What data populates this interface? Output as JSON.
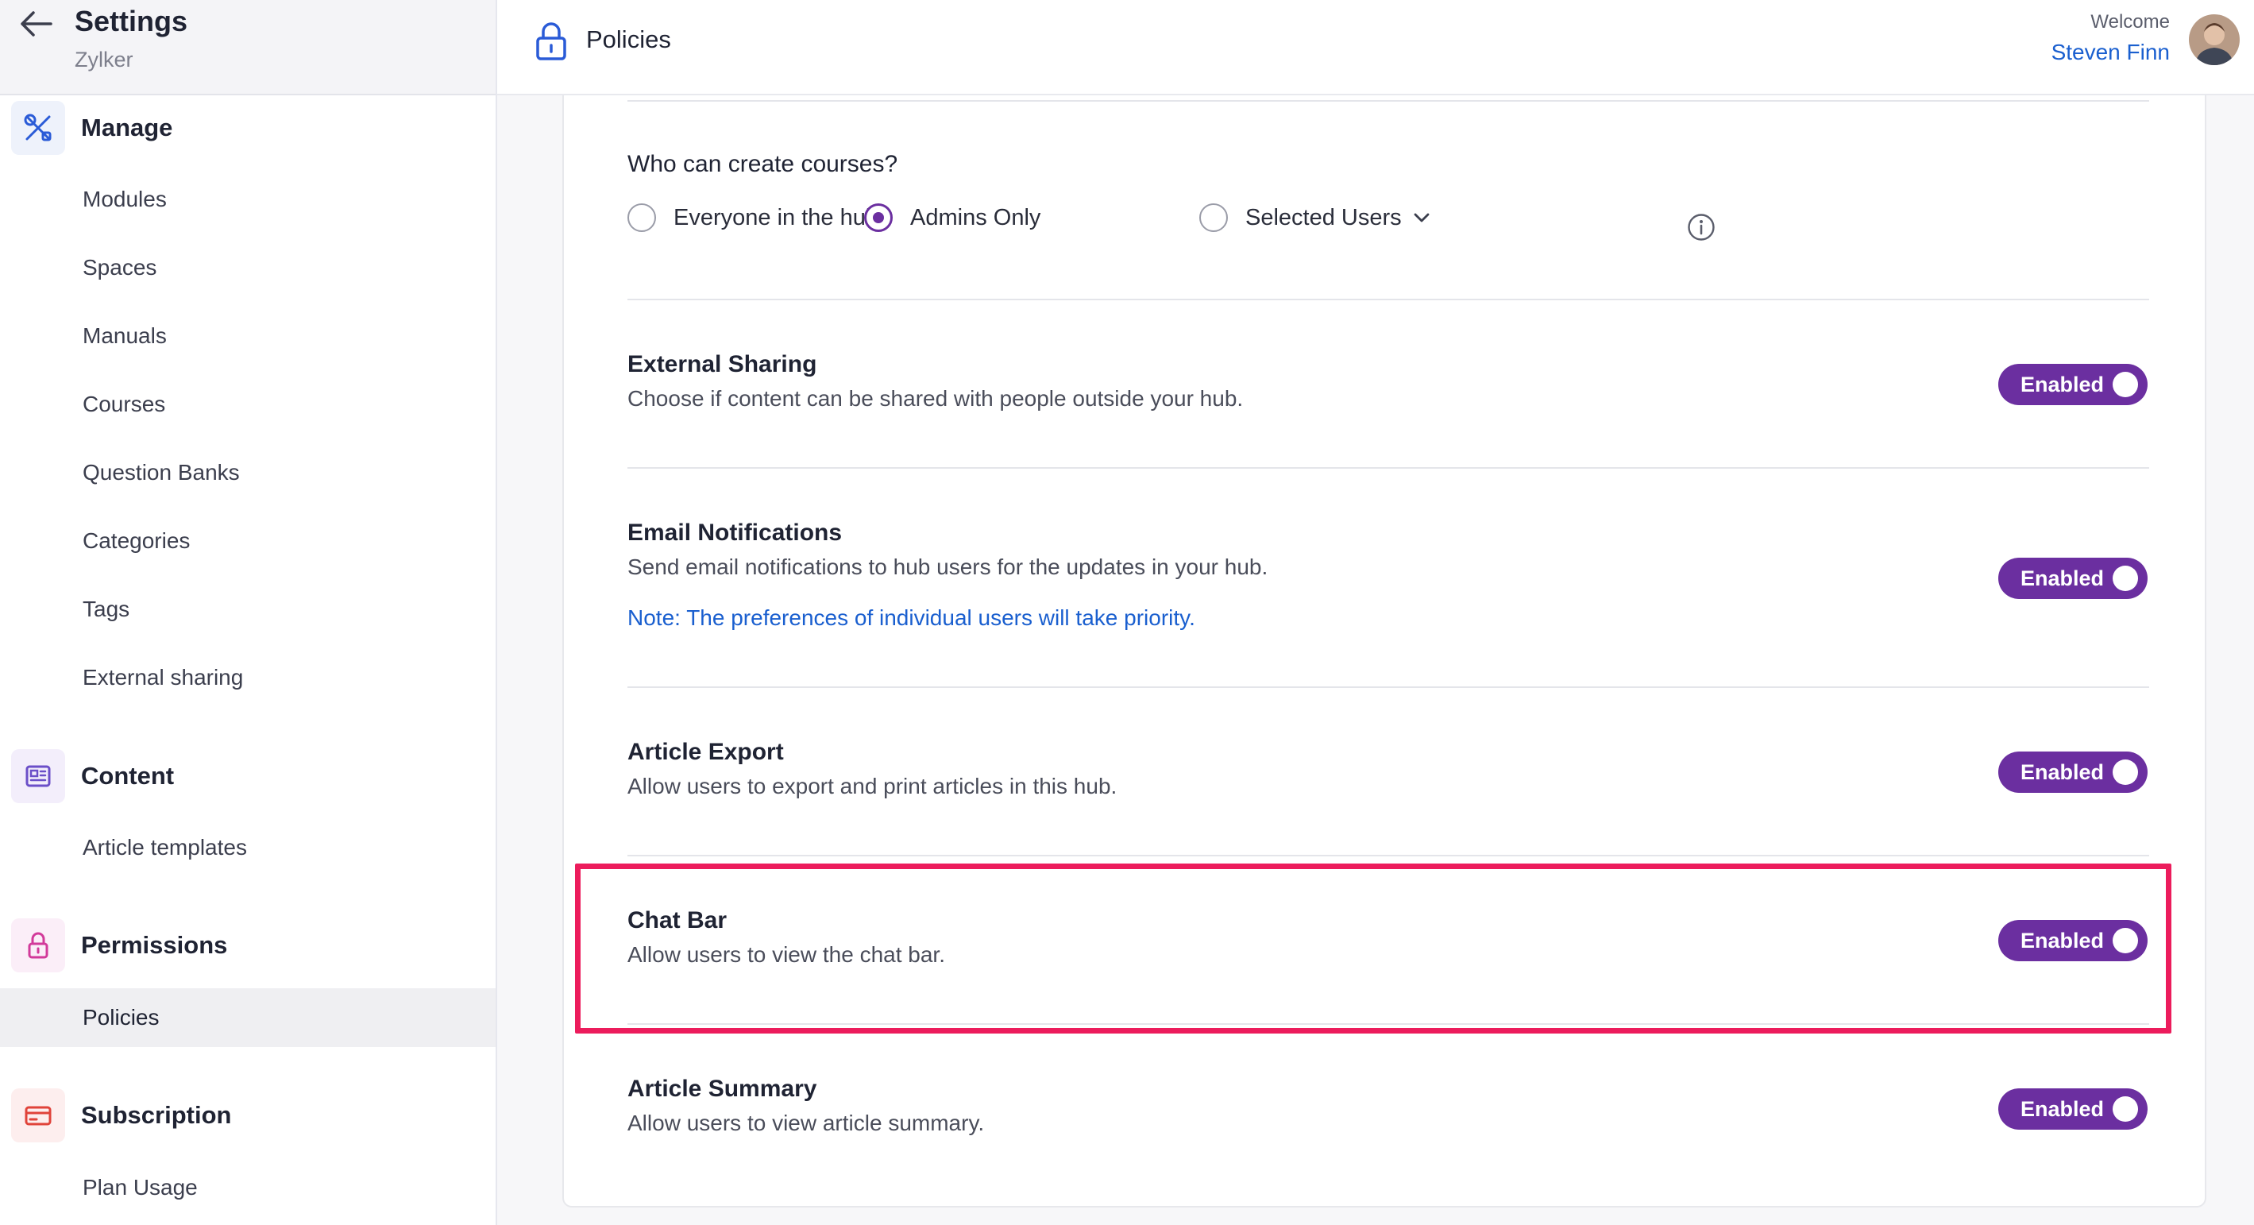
{
  "sidebar": {
    "title": "Settings",
    "org": "Zylker",
    "sections": [
      {
        "label": "Manage",
        "icon": "tools-icon",
        "items": [
          "Modules",
          "Spaces",
          "Manuals",
          "Courses",
          "Question Banks",
          "Categories",
          "Tags",
          "External sharing"
        ]
      },
      {
        "label": "Content",
        "icon": "article-icon",
        "items": [
          "Article templates"
        ]
      },
      {
        "label": "Permissions",
        "icon": "lock-icon",
        "items": [
          "Policies"
        ]
      },
      {
        "label": "Subscription",
        "icon": "credit-card-icon",
        "items": [
          "Plan Usage"
        ]
      }
    ],
    "active_item": "Policies"
  },
  "header": {
    "page_title": "Policies",
    "welcome": "Welcome",
    "username": "Steven Finn"
  },
  "course_creation": {
    "question": "Who can create courses?",
    "options": [
      "Everyone in the hub",
      "Admins Only",
      "Selected Users"
    ],
    "selected": "Admins Only"
  },
  "settings": [
    {
      "title": "External Sharing",
      "description": "Choose if content can be shared with people outside your hub.",
      "status": "Enabled"
    },
    {
      "title": "Email Notifications",
      "description": "Send email notifications to hub users for the updates in your hub.",
      "note": "Note: The preferences of individual users will take priority.",
      "status": "Enabled"
    },
    {
      "title": "Article Export",
      "description": "Allow users to export and print articles in this hub.",
      "status": "Enabled"
    },
    {
      "title": "Chat Bar",
      "description": "Allow users to view the chat bar.",
      "status": "Enabled"
    },
    {
      "title": "Article Summary",
      "description": "Allow users to view article summary.",
      "status": "Enabled"
    }
  ],
  "colors": {
    "accent": "#6b2fa0",
    "link": "#1a5fcf",
    "highlight": "#ec1c5c"
  }
}
